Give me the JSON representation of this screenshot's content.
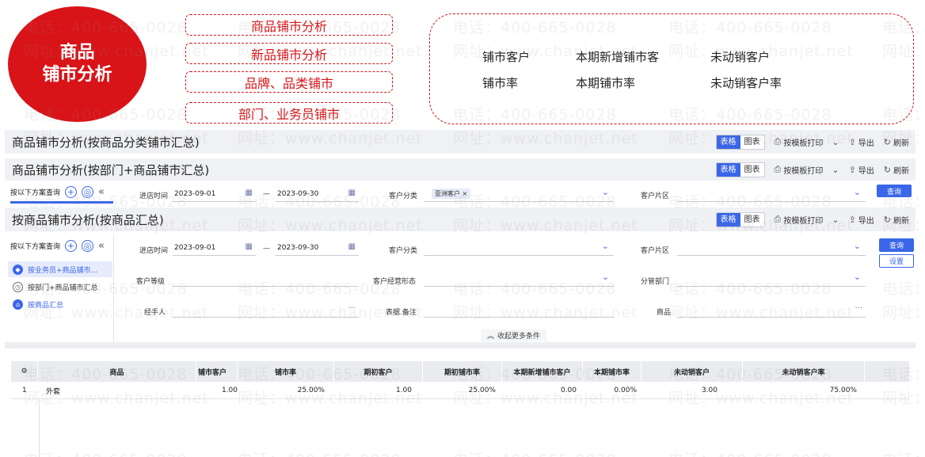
{
  "banner": {
    "circle_line1": "商品",
    "circle_line2": "铺市分析",
    "features": [
      "商品铺市分析",
      "新品铺市分析",
      "品牌、品类铺市",
      "部门、业务员铺市"
    ],
    "metrics_row1": [
      "铺市客户",
      "本期新增铺市客",
      "未动销客户"
    ],
    "metrics_row2": [
      "铺市率",
      "本期铺市率",
      "未动销客户率"
    ],
    "accent_color": "#d81418"
  },
  "watermark": {
    "phone": "电话：400-665-0028",
    "site": "网址：www.chanjet.net"
  },
  "toolbar": {
    "table_label": "表格",
    "chart_label": "图表",
    "print_label": "按模板打印",
    "export_label": "导出",
    "refresh_label": "刷新"
  },
  "sections": {
    "s1_title": "商品铺市分析(按商品分类铺市汇总)",
    "s2_title": "商品铺市分析(按部门+商品铺市汇总)",
    "s3_title": "按商品铺市分析(按商品汇总)"
  },
  "query_mid": {
    "scheme_label": "按以下方案查询",
    "date_label": "进店时间",
    "date_from": "2023-09-01",
    "date_sep": "—",
    "date_to": "2023-09-30",
    "customer_class_label": "客户分类",
    "customer_class_tag": "亚洲客户",
    "customer_area_label": "客户片区",
    "query_button": "查询"
  },
  "query": {
    "scheme_label": "按以下方案查询",
    "schemes": [
      "按业务员+商品铺市...",
      "按部门+商品铺市汇总",
      "按商品汇总"
    ],
    "date_label": "进店时间",
    "date_from": "2023-09-01",
    "date_sep": "—",
    "date_to": "2023-09-30",
    "customer_class_label": "客户分类",
    "customer_area_label": "客户片区",
    "customer_level_label": "客户等级",
    "business_form_label": "客户经营形态",
    "dept_label": "分管部门",
    "handler_label": "经手人",
    "remark_label": "表据.备注",
    "product_label": "商品",
    "more_placeholder": "···",
    "query_button": "查询",
    "settings_button": "设置",
    "collapse_label": "收起更多条件"
  },
  "table": {
    "columns": [
      "商品",
      "铺市客户",
      "铺市率",
      "期初客户",
      "期初铺市率",
      "本期新增铺市客户",
      "本期铺市率",
      "未动销客户",
      "未动销客户率"
    ],
    "rows": [
      {
        "idx": "1",
        "product": "外套",
        "shop_customers": "1.00",
        "shop_rate": "25.00%",
        "begin_customers": "1.00",
        "begin_rate": "25.00%",
        "new_customers": "0.00",
        "period_rate": "0.00%",
        "unsold_customers": "3.00",
        "unsold_rate": "75.00%"
      }
    ]
  }
}
